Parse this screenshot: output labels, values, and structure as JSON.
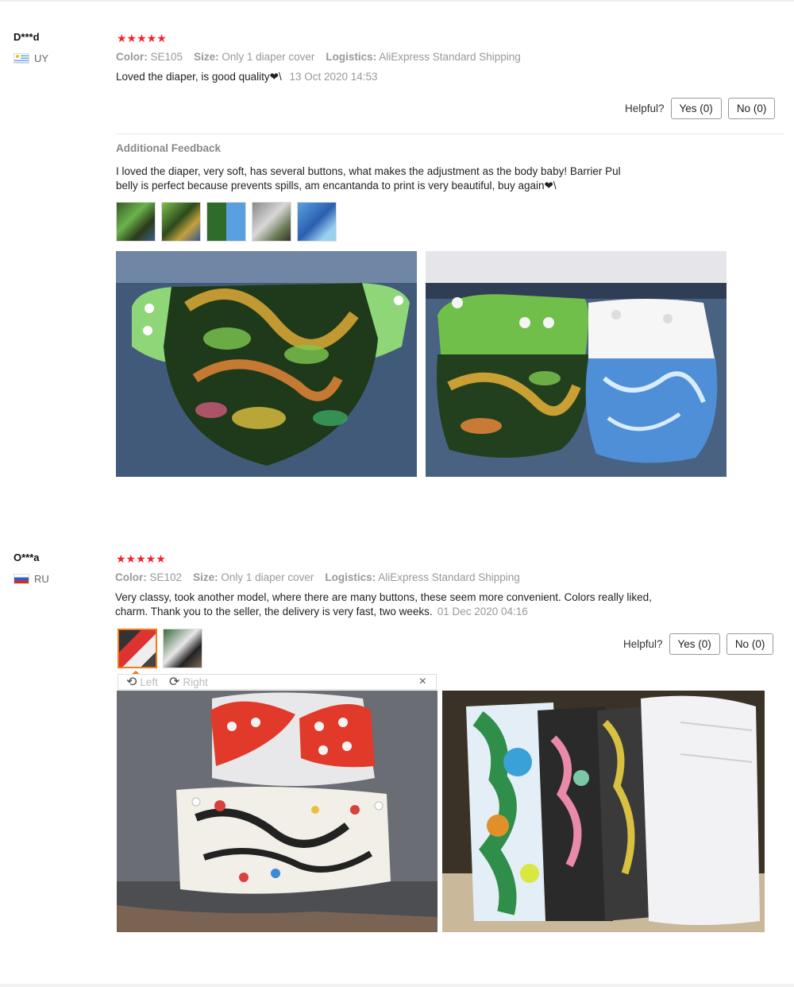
{
  "reviews": [
    {
      "user": "D***d",
      "country": "UY",
      "stars": "★★★★★",
      "color_label": "Color:",
      "color_value": "SE105",
      "size_label": "Size:",
      "size_value": "Only 1 diaper cover",
      "logistics_label": "Logistics:",
      "logistics_value": "AliExpress Standard Shipping",
      "text": "Loved the diaper, is good quality❤\\",
      "date": "13 Oct 2020 14:53",
      "helpful_label": "Helpful?",
      "yes_label": "Yes (0)",
      "no_label": "No (0)",
      "additional_title": "Additional Feedback",
      "additional_line1": "I loved the diaper, very soft, has several buttons, what makes the adjustment as the body baby! Barrier Pul",
      "additional_line2": "belly is perfect because prevents spills, am encantanda to print is very beautiful, buy again❤\\"
    },
    {
      "user": "O***a",
      "country": "RU",
      "stars": "★★★★★",
      "color_label": "Color:",
      "color_value": "SE102",
      "size_label": "Size:",
      "size_value": "Only 1 diaper cover",
      "logistics_label": "Logistics:",
      "logistics_value": "AliExpress Standard Shipping",
      "text_line1": "Very classy, took another model, where there are many buttons, these seem more convenient. Colors really liked,",
      "text_line2": "charm. Thank you to the seller, the delivery is very fast, two weeks.",
      "date": "01 Dec 2020 04:16",
      "helpful_label": "Helpful?",
      "yes_label": "Yes (0)",
      "no_label": "No (0)",
      "rotate_left": "Left",
      "rotate_right": "Right",
      "close_symbol": "×"
    }
  ],
  "icons": {
    "rotate_left": "rotate-left-icon",
    "rotate_right": "rotate-right-icon",
    "close": "close-icon",
    "star": "star-icon"
  },
  "colors": {
    "star": "#f5222d",
    "selected_thumb": "#f07a1a",
    "muted_text": "#999999"
  }
}
